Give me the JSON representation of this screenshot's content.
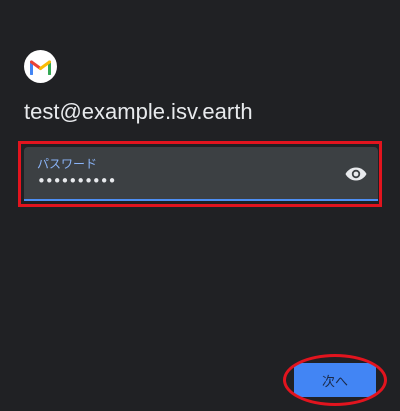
{
  "app": {
    "logo_icon": "gmail-logo",
    "accent_color": "#4285f4",
    "highlight_color": "#e2141e"
  },
  "account": {
    "email": "test@example.isv.earth"
  },
  "password": {
    "label": "パスワード",
    "value": "••••••••••",
    "toggle_icon": "eye-icon"
  },
  "actions": {
    "next_label": "次へ"
  }
}
